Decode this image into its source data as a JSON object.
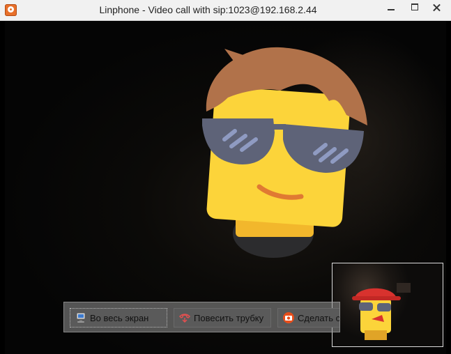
{
  "window": {
    "title": "Linphone - Video call with sip:1023@192.168.2.44"
  },
  "icons": {
    "app": "linphone-icon",
    "fullscreen": "monitor-icon",
    "hangup": "hangup-phone-icon",
    "screenshot": "camera-icon"
  },
  "controls": {
    "fullscreen_label": "Во весь экран",
    "hangup_label": "Повесить трубку",
    "screenshot_label": "Сделать скрин"
  },
  "colors": {
    "hangup_accent": "#e05050",
    "screenshot_accent": "#e84e1b"
  }
}
